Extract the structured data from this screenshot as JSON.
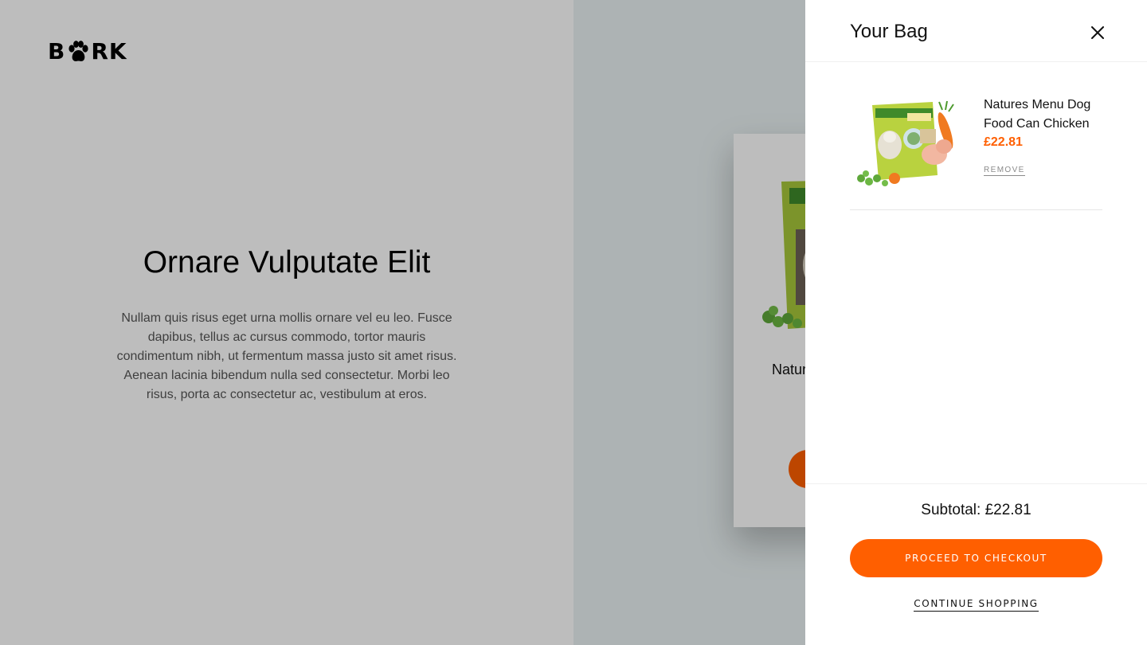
{
  "brand": {
    "logo_letters": [
      "B",
      "R",
      "K"
    ],
    "logo_icon": "paw-icon"
  },
  "hero": {
    "title": "Ornare Vulputate Elit",
    "text": "Nullam quis risus eget urna mollis ornare vel eu leo. Fusce dapibus, tellus ac cursus commodo, tortor mauris condimentum nibh, ut fermentum massa justo sit amet risus. Aenean lacinia bibendum nulla sed consectetur. Morbi leo risus, porta ac consectetur ac, vestibulum at eros."
  },
  "product_card": {
    "name_visible": "Natur",
    "image_icon": "dog-food-bag-image"
  },
  "cart": {
    "title": "Your Bag",
    "close_icon": "close-icon",
    "items": [
      {
        "name": "Natures Menu Dog Food Can Chicken",
        "price": "£22.81",
        "remove_label": "REMOVE",
        "image_icon": "dog-food-bag-image"
      }
    ],
    "subtotal": "Subtotal: £22.81",
    "checkout_label": "PROCEED TO CHECKOUT",
    "continue_label": "CONTINUE SHOPPING"
  },
  "colors": {
    "accent": "#ff5f00",
    "overlay": "rgba(0,0,0,0.26)",
    "right_panel_bg": "#eaf2f3",
    "left_panel_bg": "#ffffff"
  }
}
